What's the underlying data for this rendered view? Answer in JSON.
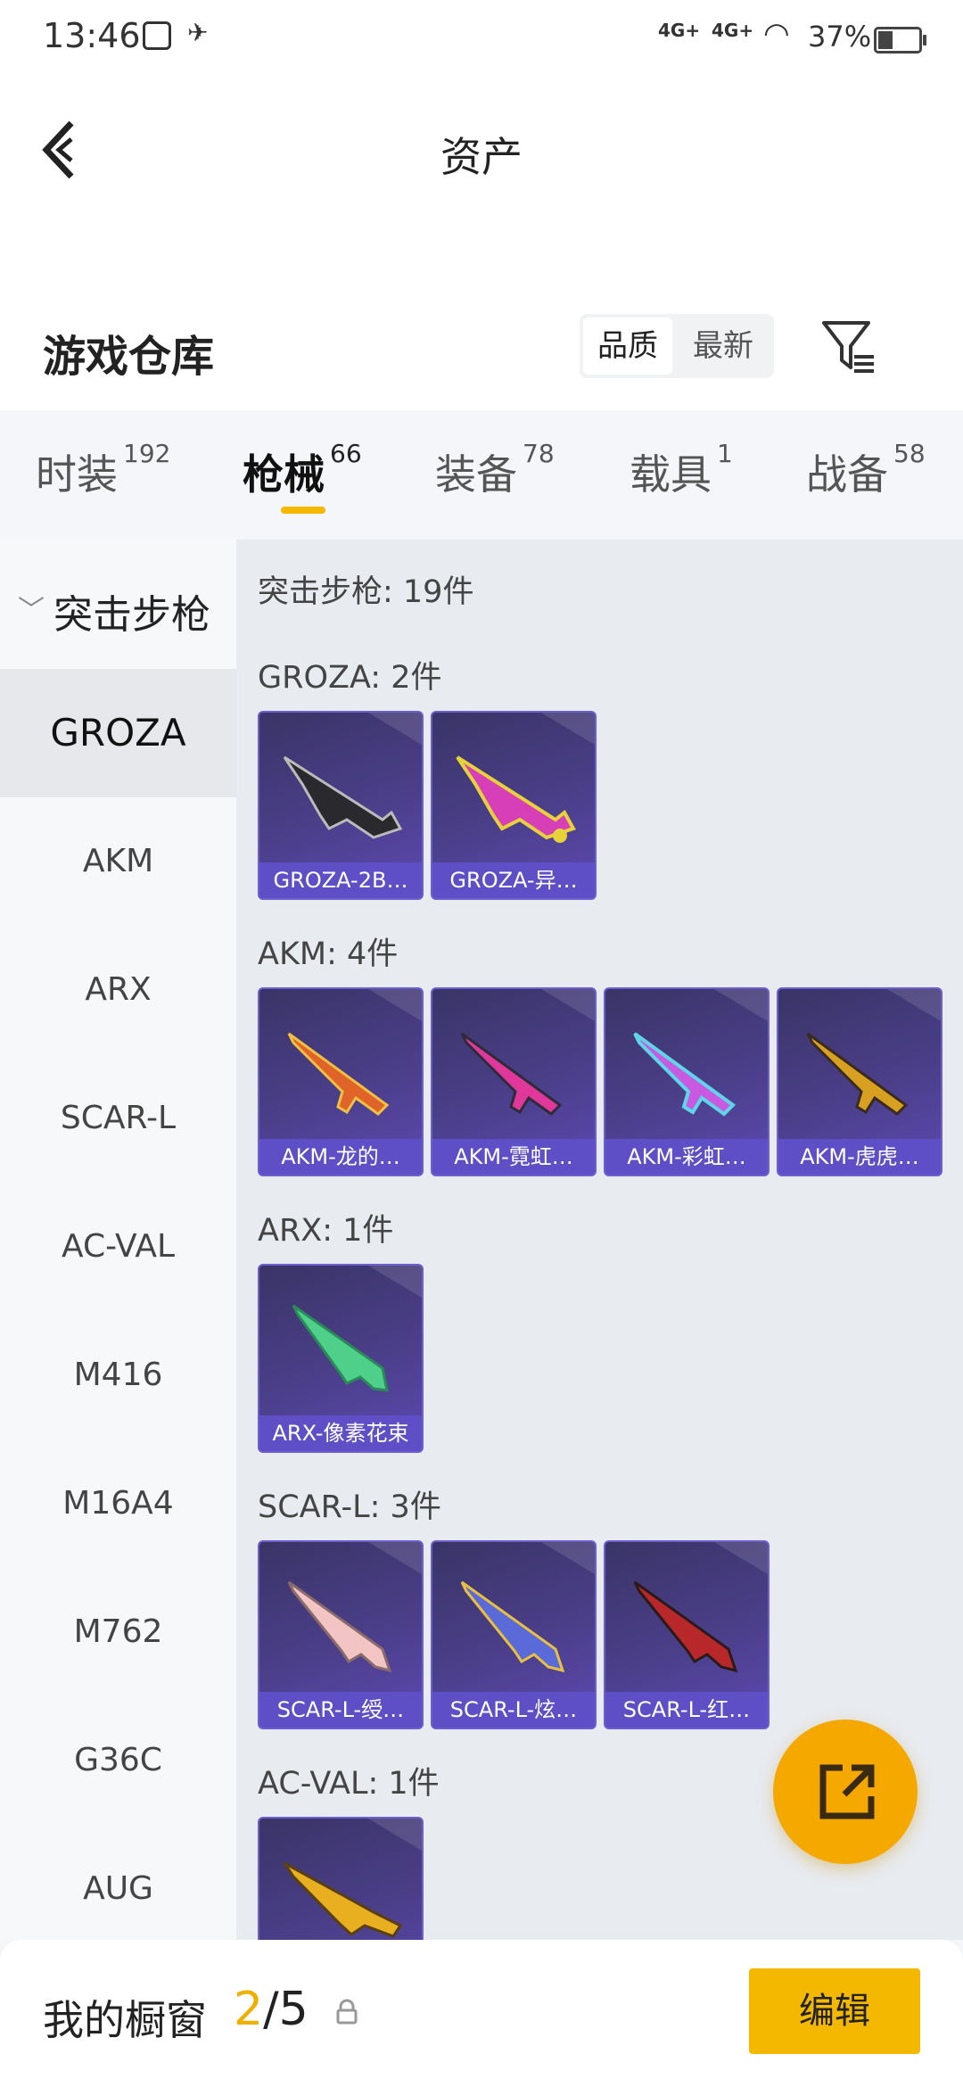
{
  "status_bar": {
    "time": "13:46",
    "signal1": "4G+",
    "signal2": "4G+",
    "battery": "37%"
  },
  "header": {
    "title": "资产"
  },
  "warehouse": {
    "title": "游戏仓库",
    "sort_quality": "品质",
    "sort_newest": "最新"
  },
  "tabs": [
    {
      "label": "时装",
      "count": "192"
    },
    {
      "label": "枪械",
      "count": "66"
    },
    {
      "label": "装备",
      "count": "78"
    },
    {
      "label": "载具",
      "count": "1"
    },
    {
      "label": "战备",
      "count": "58"
    }
  ],
  "sidebar": {
    "category": "突击步枪",
    "items": [
      "GROZA",
      "AKM",
      "ARX",
      "SCAR-L",
      "AC-VAL",
      "M416",
      "M16A4",
      "M762",
      "G36C",
      "AUG"
    ]
  },
  "content": {
    "summary": "突击步枪: 19件",
    "groups": [
      {
        "title": "GROZA: 2件",
        "items": [
          "GROZA-2B…",
          "GROZA-异…"
        ]
      },
      {
        "title": "AKM: 4件",
        "items": [
          "AKM-龙的…",
          "AKM-霓虹…",
          "AKM-彩虹…",
          "AKM-虎虎…"
        ]
      },
      {
        "title": "ARX: 1件",
        "items": [
          "ARX-像素花束"
        ]
      },
      {
        "title": "SCAR-L: 3件",
        "items": [
          "SCAR-L-绶…",
          "SCAR-L-炫…",
          "SCAR-L-红…"
        ]
      },
      {
        "title": "AC-VAL: 1件",
        "items": [
          ""
        ]
      }
    ]
  },
  "bottom_bar": {
    "label": "我的橱窗",
    "current": "2",
    "total": "/5",
    "edit": "编辑"
  },
  "colors": {
    "accent": "#f5b800",
    "card_bg": "#4b3f8a",
    "card_label": "#5e4fc6"
  }
}
